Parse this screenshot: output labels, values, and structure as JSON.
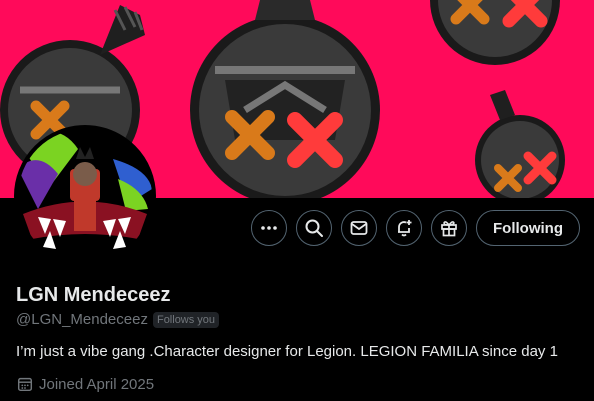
{
  "profile": {
    "display_name": "LGN Mendeceez",
    "handle": "@LGN_Mendeceez",
    "follows_you_badge": "Follows you",
    "bio": "I’m just a vibe gang .Character designer for Legion. LEGION FAMILIA since day 1",
    "joined": "Joined April 2025"
  },
  "actions": {
    "following_label": "Following",
    "icons": [
      "more-icon",
      "search-icon",
      "message-icon",
      "notify-icon",
      "gift-icon"
    ]
  },
  "colors": {
    "banner_bg": "#ff0a5a",
    "page_bg": "#000000",
    "text_primary": "#e7e9ea",
    "text_secondary": "#71767b",
    "border": "#536471"
  }
}
